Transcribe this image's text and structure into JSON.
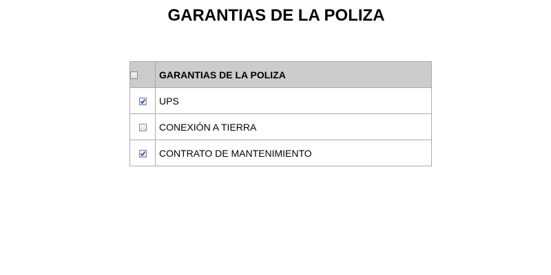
{
  "page": {
    "title": "GARANTIAS DE LA POLIZA"
  },
  "table": {
    "header": {
      "label": "GARANTIAS DE LA POLIZA",
      "checked": false
    },
    "rows": [
      {
        "label": "UPS",
        "checked": true
      },
      {
        "label": "CONEXIÓN A TIERRA",
        "checked": false
      },
      {
        "label": "CONTRATO DE MANTENIMIENTO",
        "checked": true
      }
    ]
  },
  "colors": {
    "header_bg": "#cccccc",
    "border": "#aaaaaa",
    "check": "#2a3a8a"
  }
}
